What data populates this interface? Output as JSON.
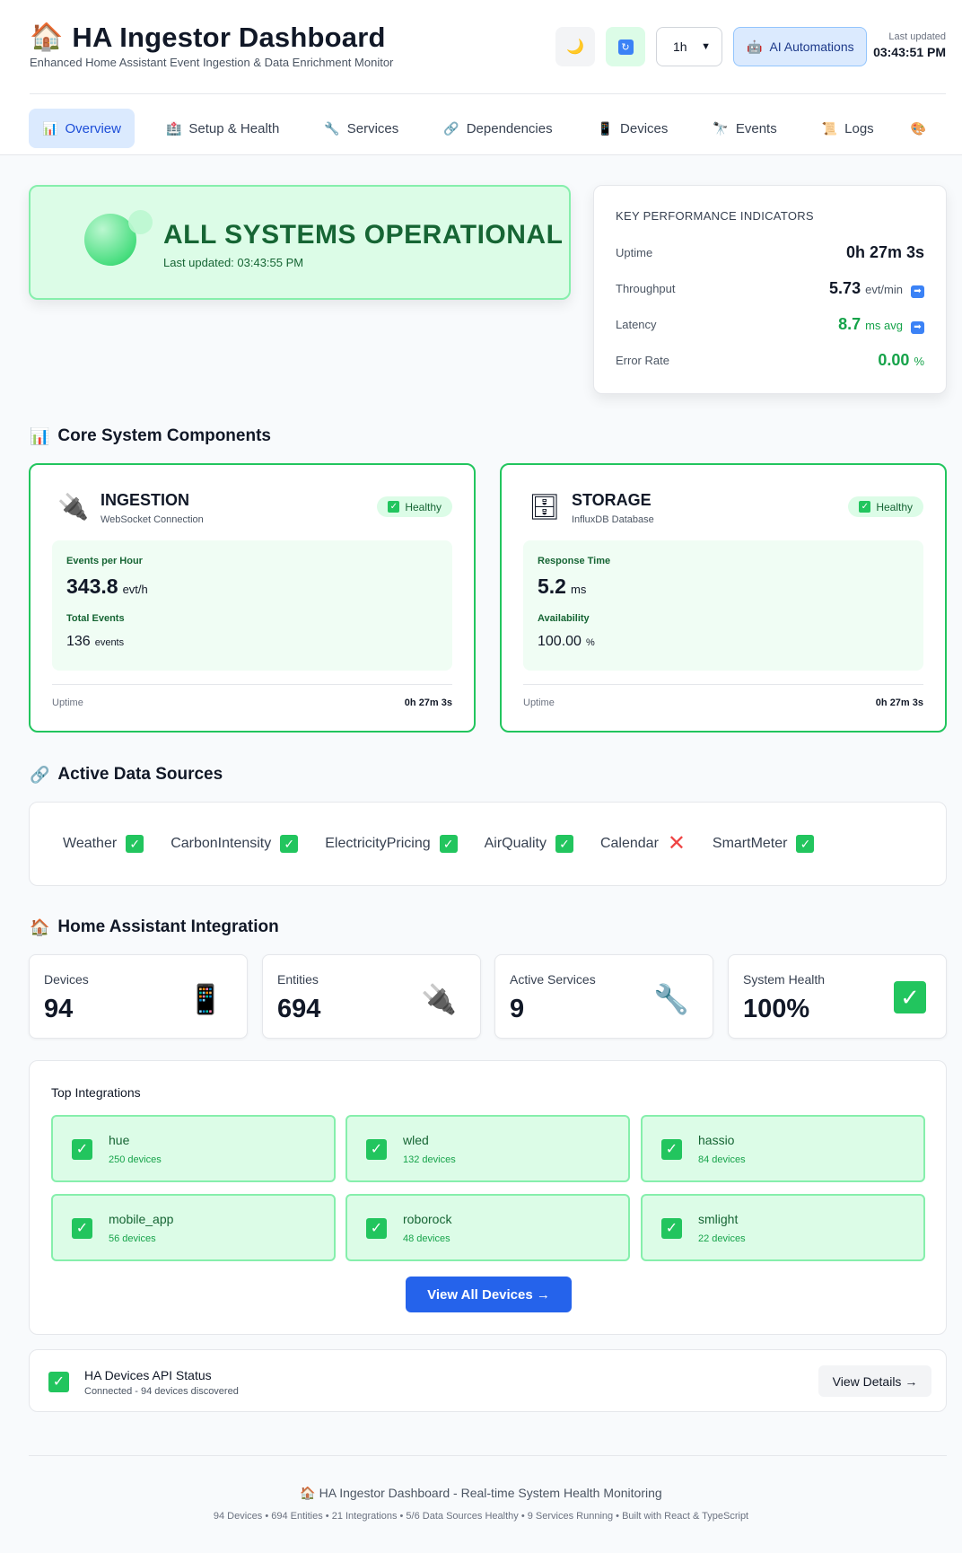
{
  "header": {
    "icon": "house-icon",
    "title": "HA Ingestor Dashboard",
    "subtitle": "Enhanced Home Assistant Event Ingestion & Data Enrichment Monitor",
    "theme_toggle_icon": "moon-icon",
    "refresh_icon": "refresh-icon",
    "time_range": "1h",
    "ai_button_label": "AI Automations",
    "ai_button_icon": "robot-icon",
    "last_updated_label": "Last updated",
    "last_updated_value": "03:43:51 PM"
  },
  "tabs": [
    {
      "label": "Overview",
      "icon": "chart-icon"
    },
    {
      "label": "Setup & Health",
      "icon": "setup-icon"
    },
    {
      "label": "Services",
      "icon": "wrench-icon"
    },
    {
      "label": "Dependencies",
      "icon": "link-icon"
    },
    {
      "label": "Devices",
      "icon": "device-icon"
    },
    {
      "label": "Events",
      "icon": "telescope-icon"
    },
    {
      "label": "Logs",
      "icon": "scroll-icon"
    }
  ],
  "status": {
    "title": "ALL SYSTEMS OPERATIONAL",
    "updated": "Last updated: 03:43:55 PM"
  },
  "kpi": {
    "title": "KEY PERFORMANCE INDICATORS",
    "rows": [
      {
        "label": "Uptime",
        "value": "0h 27m 3s",
        "unit": ""
      },
      {
        "label": "Throughput",
        "value": "5.73",
        "unit": "evt/min"
      },
      {
        "label": "Latency",
        "value": "8.7",
        "unit": "ms avg"
      },
      {
        "label": "Error Rate",
        "value": "0.00",
        "unit": "%"
      }
    ]
  },
  "core": {
    "title": "Core System Components",
    "components": [
      {
        "name": "INGESTION",
        "desc": "WebSocket Connection",
        "status": "Healthy",
        "icon": "plug-icon",
        "m1_label": "Events per Hour",
        "m1_value": "343.8",
        "m1_unit": "evt/h",
        "m2_label": "Total Events",
        "m2_value": "136",
        "m2_unit": "events",
        "uptime_label": "Uptime",
        "uptime_value": "0h 27m 3s"
      },
      {
        "name": "STORAGE",
        "desc": "InfluxDB Database",
        "status": "Healthy",
        "icon": "database-icon",
        "m1_label": "Response Time",
        "m1_value": "5.2",
        "m1_unit": "ms",
        "m2_label": "Availability",
        "m2_value": "100.00",
        "m2_unit": "%",
        "uptime_label": "Uptime",
        "uptime_value": "0h 27m 3s"
      }
    ]
  },
  "sources": {
    "title": "Active Data Sources",
    "items": [
      {
        "name": "Weather",
        "ok": true
      },
      {
        "name": "CarbonIntensity",
        "ok": true
      },
      {
        "name": "ElectricityPricing",
        "ok": true
      },
      {
        "name": "AirQuality",
        "ok": true
      },
      {
        "name": "Calendar",
        "ok": false
      },
      {
        "name": "SmartMeter",
        "ok": true
      }
    ]
  },
  "ha": {
    "title": "Home Assistant Integration",
    "stats": [
      {
        "label": "Devices",
        "value": "94",
        "icon": "device-icon"
      },
      {
        "label": "Entities",
        "value": "694",
        "icon": "plug-icon"
      },
      {
        "label": "Active Services",
        "value": "9",
        "icon": "wrench-icon"
      },
      {
        "label": "System Health",
        "value": "100%",
        "icon": "check-icon"
      }
    ],
    "top_title": "Top Integrations",
    "integrations": [
      {
        "name": "hue",
        "devices": "250 devices"
      },
      {
        "name": "wled",
        "devices": "132 devices"
      },
      {
        "name": "hassio",
        "devices": "84 devices"
      },
      {
        "name": "mobile_app",
        "devices": "56 devices"
      },
      {
        "name": "roborock",
        "devices": "48 devices"
      },
      {
        "name": "smlight",
        "devices": "22 devices"
      }
    ],
    "view_all_label": "View All Devices →"
  },
  "api": {
    "title": "HA Devices API Status",
    "status": "Connected - 94 devices discovered",
    "button": "View Details →"
  },
  "footer": {
    "title": "🏠 HA Ingestor Dashboard - Real-time System Health Monitoring",
    "sub": "94 Devices • 694 Entities • 21 Integrations • 5/6 Data Sources Healthy • 9 Services Running • Built with React & TypeScript"
  },
  "colors": {
    "accent": "#2563eb",
    "healthy": "#22c55e",
    "healthy_bg": "#dcfce7",
    "error": "#ef4444"
  }
}
